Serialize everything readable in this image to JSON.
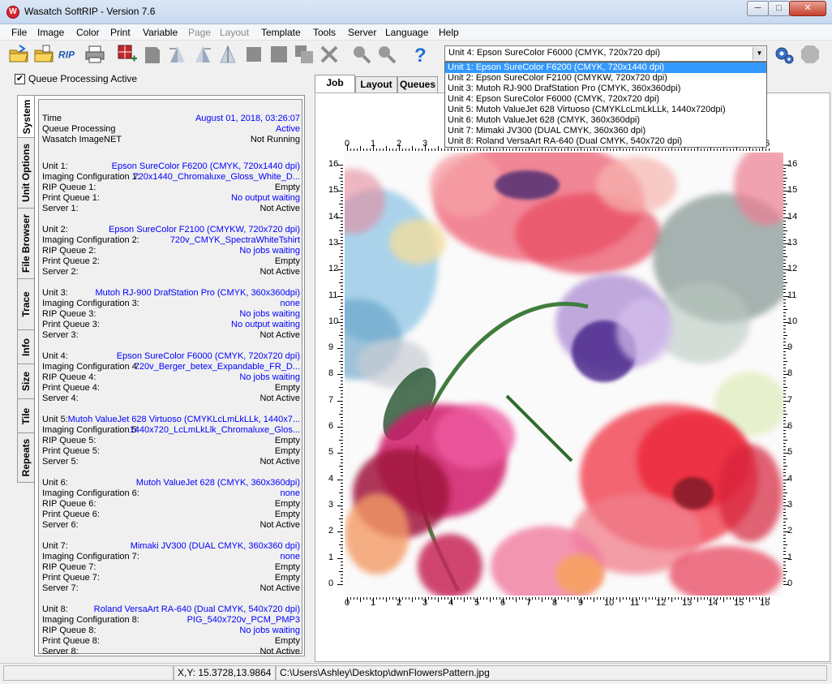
{
  "window": {
    "title": "Wasatch SoftRIP - Version 7.6",
    "minimize": "─",
    "maximize": "□",
    "close": "✕",
    "logo": "W"
  },
  "menu": [
    "File",
    "Image",
    "Color",
    "Print",
    "Variable",
    "Page",
    "Layout",
    "Template",
    "Tools",
    "Server",
    "Language",
    "Help"
  ],
  "menu_disabled": [
    "Page",
    "Layout"
  ],
  "unit_select": {
    "value": "Unit 4: Epson  SureColor F6000  (CMYK, 720x720 dpi)",
    "options": [
      "Unit 1: Epson  SureColor F6200  (CMYK, 720x1440 dpi)",
      "Unit 2: Epson  SureColor F2100 (CMYKW, 720x720 dpi)",
      "Unit 3: Mutoh  RJ-900 DrafStation Pro (CMYK, 360x360dpi)",
      "Unit 4: Epson  SureColor F6000  (CMYK, 720x720 dpi)",
      "Unit 5: Mutoh  ValueJet 628 Virtuoso (CMYKLcLmLkLLk, 1440x720dpi)",
      "Unit 6: Mutoh  ValueJet 628 (CMYK, 360x360dpi)",
      "Unit 7: Mimaki  JV300 (DUAL CMYK, 360x360 dpi)",
      "Unit 8: Roland  VersaArt RA-640 (Dual CMYK, 540x720 dpi)"
    ],
    "selected_index": 0
  },
  "queue_processing_label": "Queue Processing Active",
  "queue_processing_checked": "✔",
  "left_tabs": [
    "System",
    "Unit Options",
    "File Browser",
    "Trace",
    "Info",
    "Size",
    "Tile",
    "Repeats"
  ],
  "right_tabs": [
    "Job",
    "Layout",
    "Queues"
  ],
  "system_header": [
    {
      "label": "Time",
      "value": "August 01, 2018,  03:26:07",
      "blue": true
    },
    {
      "label": "Queue Processing",
      "value": "Active",
      "blue": true
    },
    {
      "label": "Wasatch ImageNET",
      "value": "Not Running",
      "blue": false
    }
  ],
  "units": [
    {
      "unit_label": "Unit 1:",
      "unit_value": "Epson  SureColor F6200  (CMYK, 720x1440 dpi)",
      "config_label": "Imaging Configuration 1:",
      "config_value": "720x1440_Chromaluxe_Gloss_White_D...",
      "rip_label": "RIP Queue 1:",
      "rip_value": "Empty",
      "rip_blue": false,
      "print_label": "Print Queue 1:",
      "print_value": "No output waiting",
      "print_blue": true,
      "server_label": "Server 1:",
      "server_value": "Not Active"
    },
    {
      "unit_label": "Unit 2:",
      "unit_value": "Epson  SureColor F2100 (CMYKW, 720x720 dpi)",
      "config_label": "Imaging Configuration 2:",
      "config_value": "720v_CMYK_SpectraWhiteTshirt",
      "rip_label": "RIP Queue 2:",
      "rip_value": "No jobs waiting",
      "rip_blue": true,
      "print_label": "Print Queue 2:",
      "print_value": "Empty",
      "print_blue": false,
      "server_label": "Server 2:",
      "server_value": "Not Active"
    },
    {
      "unit_label": "Unit 3:",
      "unit_value": "Mutoh  RJ-900 DrafStation Pro (CMYK, 360x360dpi)",
      "config_label": "Imaging Configuration 3:",
      "config_value": "none",
      "rip_label": "RIP Queue 3:",
      "rip_value": "No jobs waiting",
      "rip_blue": true,
      "print_label": "Print Queue 3:",
      "print_value": "No output waiting",
      "print_blue": true,
      "server_label": "Server 3:",
      "server_value": "Not Active"
    },
    {
      "unit_label": "Unit 4:",
      "unit_value": "Epson  SureColor F6000  (CMYK, 720x720 dpi)",
      "config_label": "Imaging Configuration 4:",
      "config_value": "720v_Berger_betex_Expandable_FR_D...",
      "rip_label": "RIP Queue 4:",
      "rip_value": "No jobs waiting",
      "rip_blue": true,
      "print_label": "Print Queue 4:",
      "print_value": "Empty",
      "print_blue": false,
      "server_label": "Server 4:",
      "server_value": "Not Active"
    },
    {
      "unit_label": "Unit 5:",
      "unit_value": "Mutoh  ValueJet 628 Virtuoso (CMYKLcLmLkLLk, 1440x7...",
      "config_label": "Imaging Configuration 5:",
      "config_value": "1440x720_LcLmLkLlk_Chromaluxe_Glos...",
      "rip_label": "RIP Queue 5:",
      "rip_value": "Empty",
      "rip_blue": false,
      "print_label": "Print Queue 5:",
      "print_value": "Empty",
      "print_blue": false,
      "server_label": "Server 5:",
      "server_value": "Not Active"
    },
    {
      "unit_label": "Unit 6:",
      "unit_value": "Mutoh  ValueJet 628 (CMYK, 360x360dpi)",
      "config_label": "Imaging Configuration 6:",
      "config_value": "none",
      "rip_label": "RIP Queue 6:",
      "rip_value": "Empty",
      "rip_blue": false,
      "print_label": "Print Queue 6:",
      "print_value": "Empty",
      "print_blue": false,
      "server_label": "Server 6:",
      "server_value": "Not Active"
    },
    {
      "unit_label": "Unit 7:",
      "unit_value": "Mimaki  JV300 (DUAL CMYK, 360x360 dpi)",
      "config_label": "Imaging Configuration 7:",
      "config_value": "none",
      "rip_label": "RIP Queue 7:",
      "rip_value": "Empty",
      "rip_blue": false,
      "print_label": "Print Queue 7:",
      "print_value": "Empty",
      "print_blue": false,
      "server_label": "Server 7:",
      "server_value": "Not Active"
    },
    {
      "unit_label": "Unit 8:",
      "unit_value": "Roland  VersaArt RA-640 (Dual CMYK, 540x720 dpi)",
      "config_label": "Imaging Configuration 8:",
      "config_value": "PIG_540x720v_PCM_PMP3",
      "rip_label": "RIP Queue 8:",
      "rip_value": "No jobs waiting",
      "rip_blue": true,
      "print_label": "Print Queue 8:",
      "print_value": "Empty",
      "print_blue": false,
      "server_label": "Server 8:",
      "server_value": "Not Active"
    }
  ],
  "ruler": {
    "h_labels": [
      "0",
      "1",
      "2",
      "3",
      "4",
      "5",
      "6",
      "7",
      "8",
      "9",
      "10",
      "11",
      "12",
      "13",
      "14",
      "15",
      "16"
    ],
    "v_labels": [
      "16",
      "15",
      "14",
      "13",
      "12",
      "11",
      "10",
      "9",
      "8",
      "7",
      "6",
      "5",
      "4",
      "3",
      "2",
      "1",
      "0"
    ]
  },
  "statusbar": {
    "coords": "X,Y: 15.3728,13.9864",
    "path": "C:\\Users\\Ashley\\Desktop\\dwnFlowersPattern.jpg"
  },
  "icons": [
    "open-folder-icon",
    "open-file-icon",
    "rip-icon",
    "printer-icon",
    "add-layout-icon",
    "page-icon",
    "mirror-left-icon",
    "mirror-right-icon",
    "flip-icon",
    "crop-icon",
    "stack-icon",
    "copy-icon",
    "delete-icon",
    "zoom-in-icon",
    "zoom-out-icon",
    "help-icon",
    "gear-icon",
    "stop-icon"
  ],
  "colors": {
    "blue_value": "#0000ff",
    "selection": "#3399ff",
    "rip_red": "#c0282b"
  }
}
